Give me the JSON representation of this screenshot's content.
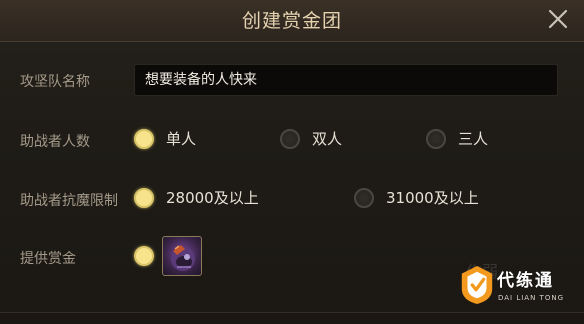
{
  "dialog": {
    "title": "创建赏金团",
    "close_icon": "close-icon"
  },
  "form": {
    "team_name": {
      "label": "攻坚队名称",
      "value": "想要装备的人快来"
    },
    "helper_count": {
      "label": "助战者人数",
      "options": [
        {
          "label": "单人",
          "selected": true
        },
        {
          "label": "双人",
          "selected": false
        },
        {
          "label": "三人",
          "selected": false
        }
      ]
    },
    "demon_resist": {
      "label": "助战者抗魔限制",
      "options": [
        {
          "label": "28000及以上",
          "selected": true
        },
        {
          "label": "31000及以上",
          "selected": false
        }
      ]
    },
    "reward": {
      "label": "提供赏金",
      "selected": true,
      "item_icon": "reward-item-icon"
    }
  },
  "watermark": {
    "brand": "代练通",
    "sub": "DAI LIAN TONG",
    "faint": "作弱"
  },
  "colors": {
    "accent_selected": "#f6e38c",
    "label": "#a49a8a",
    "title": "#e4d2b0"
  }
}
